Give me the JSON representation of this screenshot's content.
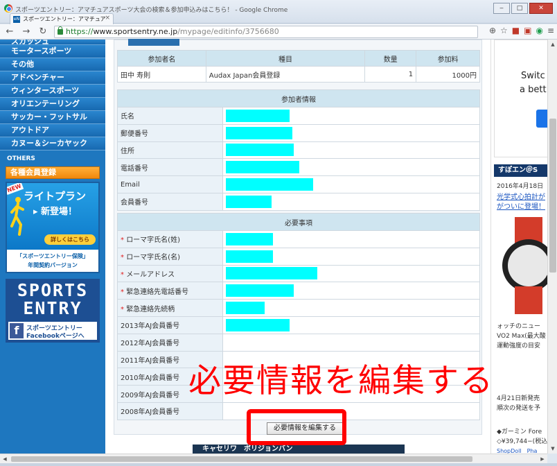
{
  "window": {
    "title": "スポーツエントリー：アマチュアスポーツ大会の検索＆参加申込みはこちら！ - Google Chrome",
    "tab_label": "スポーツエントリー：アマチュア",
    "tab_favicon": "eN",
    "min": "‒",
    "max": "□",
    "close": "✕"
  },
  "toolbar": {
    "url_scheme": "https://",
    "url_host": "www.sportsentry.ne.jp",
    "url_path": "/mypage/editinfo/3756680"
  },
  "leftnav": {
    "items": [
      "スカッシュ",
      "モータースポーツ",
      "その他",
      "アドベンチャー",
      "ウィンタースポーツ",
      "オリエンテーリング",
      "サッカー・フットサル",
      "アウトドア",
      "カヌー＆シーカヤック"
    ],
    "others_label": "OTHERS",
    "member_button": "各種会員登録",
    "banner": {
      "new": "NEW",
      "title": "ライトプラン",
      "subtitle": "▸ 新登場！",
      "button": "詳しくはこちら",
      "footer1": "「スポーツエントリー保険」",
      "footer2": "年間契約バージョン"
    },
    "logo": {
      "line1": "SPORTS",
      "line2": "ENTRY",
      "fb_line1": "スポーツエントリー",
      "fb_line2": "Facebookページへ"
    }
  },
  "entry_table": {
    "headers": [
      "参加者名",
      "種目",
      "数量",
      "参加料"
    ],
    "row": [
      "田中 寿則",
      "Audax Japan会員登録",
      "1",
      "1000円"
    ]
  },
  "participant": {
    "section_title": "参加者情報",
    "fields": [
      "氏名",
      "郵便番号",
      "住所",
      "電話番号",
      "Email",
      "会員番号"
    ]
  },
  "required": {
    "section_title": "必要事項",
    "fields": [
      "ローマ字氏名(姓)",
      "ローマ字氏名(名)",
      "メールアドレス",
      "緊急連絡先電話番号",
      "緊急連絡先続柄"
    ],
    "required_mark": "*",
    "optional_fields": [
      "2013年AJ会員番号",
      "2012年AJ会員番号",
      "2011年AJ会員番号",
      "2010年AJ会員番号",
      "2009年AJ会員番号",
      "2008年AJ会員番号"
    ]
  },
  "edit_button": "必要情報を編集する",
  "overlay_caption": "必要情報を編集する",
  "bottom_ad": "キャセリワ　ボリジョンバン",
  "right": {
    "ad_line1": "Switc",
    "ad_line2": "a bett",
    "news_header": "すぽエン＠S",
    "news_date": "2016年4月18日",
    "news_link1": "光学式心拍計が",
    "news_link2": "がついに登場！",
    "text1": "ォッチのニュー",
    "text2": "VO2 Max(最大酸",
    "text3": "運動強度の目安",
    "text4": "4月21日新発売",
    "text5": "順次の発送を予",
    "text6": "◆ガーミン Fore",
    "text7": "◇¥39,744−(税込",
    "bottom_links": "ShopDoll　Pha"
  }
}
